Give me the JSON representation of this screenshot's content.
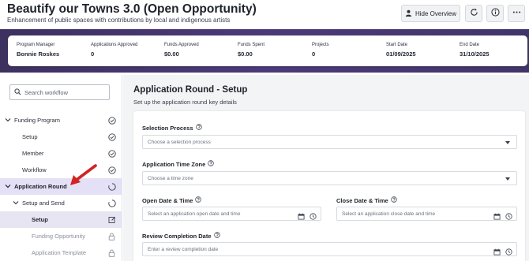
{
  "header": {
    "title": "Beautify our Towns 3.0 (Open Opportunity)",
    "subtitle": "Enhancement of public spaces with contributions by local and indigenous artists",
    "hide_overview_label": "Hide Overview",
    "icons": [
      "person-icon",
      "refresh-icon",
      "info-icon",
      "more-icon"
    ]
  },
  "stats": [
    {
      "label": "Program Manager",
      "value": "Bonnie Roskes"
    },
    {
      "label": "Applications Approved",
      "value": "0"
    },
    {
      "label": "Funds Approved",
      "value": "$0.00"
    },
    {
      "label": "Funds Spent",
      "value": "$0.00"
    },
    {
      "label": "Projects",
      "value": "0"
    },
    {
      "label": "Start Date",
      "value": "01/09/2025"
    },
    {
      "label": "End Date",
      "value": "31/10/2025"
    }
  ],
  "sidebar": {
    "search_placeholder": "Search workflow",
    "items": [
      {
        "label": "Funding Program",
        "status": "check"
      },
      {
        "label": "Setup",
        "status": "check"
      },
      {
        "label": "Member",
        "status": "check"
      },
      {
        "label": "Workflow",
        "status": "check"
      },
      {
        "label": "Application Round",
        "status": "progress"
      },
      {
        "label": "Setup and Send",
        "status": "progress"
      },
      {
        "label": "Setup",
        "status": "edit"
      },
      {
        "label": "Funding Opportunity",
        "status": "lock"
      },
      {
        "label": "Application Template",
        "status": "lock"
      }
    ]
  },
  "main": {
    "title": "Application Round - Setup",
    "subtitle": "Set up the application round key details",
    "fields": {
      "selection_process": {
        "label": "Selection Process",
        "placeholder": "Choose a selection process"
      },
      "time_zone": {
        "label": "Application Time Zone",
        "placeholder": "Choose a time zone"
      },
      "open_date": {
        "label": "Open Date & Time",
        "placeholder": "Select an application open date and time"
      },
      "close_date": {
        "label": "Close Date & Time",
        "placeholder": "Select an application close date and time"
      },
      "review_date": {
        "label": "Review Completion Date",
        "placeholder": "Enter a review completion date"
      }
    }
  },
  "colors": {
    "accent": "#4b3a7a",
    "active_nav": "#e4e0f5",
    "annotation_arrow": "#d32222"
  }
}
